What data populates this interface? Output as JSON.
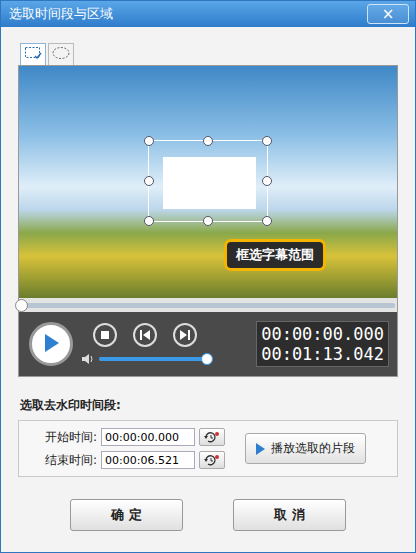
{
  "window": {
    "title": "选取时间段与区域",
    "close": "×"
  },
  "tools": [
    {
      "kind": "rectangle",
      "selected": true
    },
    {
      "kind": "ellipse",
      "selected": false
    }
  ],
  "video": {
    "callout": "框选字幕范围"
  },
  "progress": {
    "level": 0
  },
  "volume": {
    "level": 1
  },
  "times": {
    "current": "00:00:00.000",
    "total": "00:01:13.042"
  },
  "range": {
    "label": "选取去水印时间段:",
    "start": {
      "label": "开始时间:",
      "value": "00:00:00.000"
    },
    "end": {
      "label": "结束时间:",
      "value": "00:00:06.521"
    },
    "play_button": "播放选取的片段"
  },
  "buttons": [
    "确 定",
    "取 消"
  ]
}
